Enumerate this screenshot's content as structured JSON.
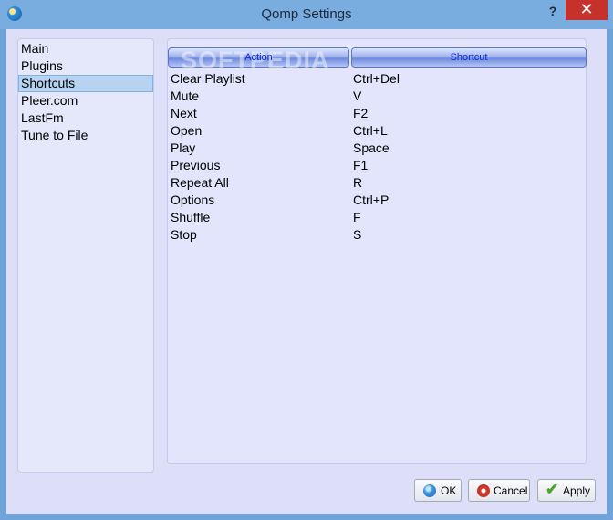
{
  "window": {
    "title": "Qomp Settings",
    "help_label": "?",
    "close_label": "✕"
  },
  "categories": [
    {
      "label": "Main"
    },
    {
      "label": "Plugins"
    },
    {
      "label": "Shortcuts",
      "selected": true
    },
    {
      "label": "Pleer.com"
    },
    {
      "label": "LastFm"
    },
    {
      "label": "Tune to File"
    }
  ],
  "shortcuts": {
    "columns": [
      "Action",
      "Shortcut"
    ],
    "rows": [
      {
        "action": "Clear Playlist",
        "shortcut": "Ctrl+Del"
      },
      {
        "action": "Mute",
        "shortcut": "V"
      },
      {
        "action": "Next",
        "shortcut": "F2"
      },
      {
        "action": "Open",
        "shortcut": "Ctrl+L"
      },
      {
        "action": "Play",
        "shortcut": "Space"
      },
      {
        "action": "Previous",
        "shortcut": "F1"
      },
      {
        "action": "Repeat All",
        "shortcut": "R"
      },
      {
        "action": "Options",
        "shortcut": "Ctrl+P"
      },
      {
        "action": "Shuffle",
        "shortcut": "F"
      },
      {
        "action": "Stop",
        "shortcut": "S"
      }
    ]
  },
  "watermark": "SOFTPEDIA",
  "buttons": {
    "ok": "OK",
    "cancel": "Cancel",
    "apply": "Apply"
  },
  "icons": {
    "app": "globe-icon",
    "ok": "globe-ok-icon",
    "cancel": "cancel-icon",
    "apply": "checkmark-icon"
  },
  "colors": {
    "titlebar": "#79acdf",
    "close": "#c7312c",
    "selection": "#b6d4f2",
    "header_text": "#0b2fd0"
  }
}
